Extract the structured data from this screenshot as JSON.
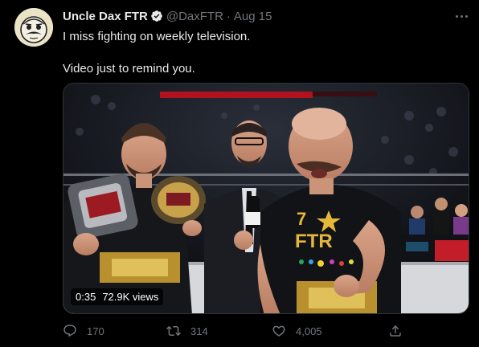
{
  "tweet": {
    "author_name": "Uncle Dax FTR",
    "handle": "@DaxFTR",
    "separator": "·",
    "date": "Aug 15",
    "text_line1": "I miss fighting on weekly television.",
    "text_line2": "Video just to remind you.",
    "verified": true,
    "avatar_icon": "cartoon-mustache-face-icon"
  },
  "media": {
    "duration": "0:35",
    "views": "72.9K views"
  },
  "actions": {
    "reply_count": "170",
    "retweet_count": "314",
    "like_count": "4,005"
  },
  "colors": {
    "background": "#000000",
    "text": "#e7e9ea",
    "secondary": "#71767b",
    "verified": "#e7e9ea"
  }
}
